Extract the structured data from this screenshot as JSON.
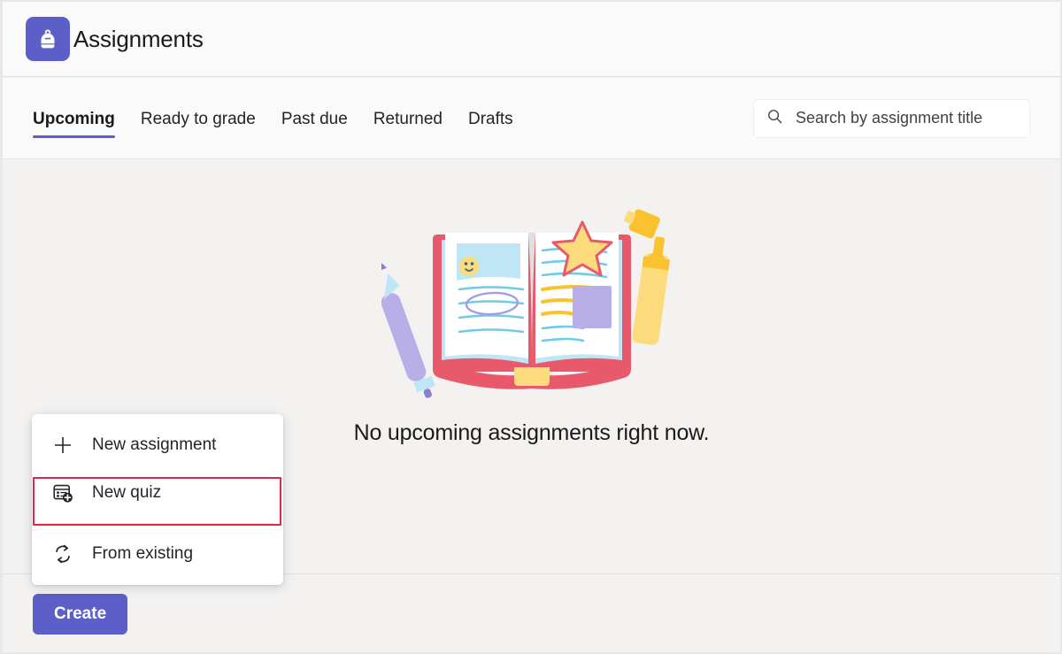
{
  "window": {
    "app_title": "Assignments",
    "app_icon": "backpack-icon",
    "accent_color": "#5b5fc7",
    "highlight_color": "#e02a43",
    "background_color": "#f3f2f1"
  },
  "tabs": [
    {
      "label": "Upcoming",
      "active": true
    },
    {
      "label": "Ready to grade",
      "active": false
    },
    {
      "label": "Past due",
      "active": false
    },
    {
      "label": "Returned",
      "active": false
    },
    {
      "label": "Drafts",
      "active": false
    }
  ],
  "search": {
    "placeholder": "Search by assignment title",
    "value": "",
    "icon": "search-icon"
  },
  "main": {
    "empty_state_text": "No upcoming assignments right now.",
    "illustration": "open-book-with-pen-and-highlighter-illustration"
  },
  "footer": {
    "create_label": "Create"
  },
  "menu": {
    "items": [
      {
        "label": "New assignment",
        "icon": "plus-icon"
      },
      {
        "label": "New quiz",
        "icon": "quiz-form-add-icon",
        "highlighted": true
      },
      {
        "label": "From existing",
        "icon": "sync-arrows-icon"
      }
    ]
  }
}
